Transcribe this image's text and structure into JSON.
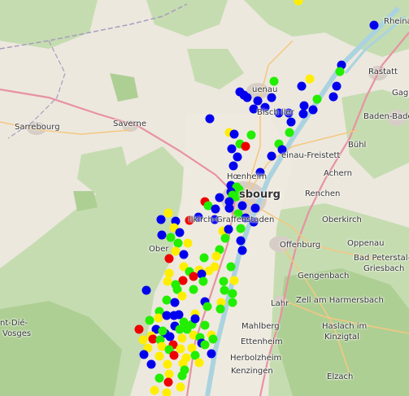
{
  "map": {
    "labels": [
      {
        "id": "rheinau",
        "text": "Rheinau"
      },
      {
        "id": "rastatt",
        "text": "Rastatt"
      },
      {
        "id": "gag",
        "text": "Gag"
      },
      {
        "id": "haguenau",
        "text": "uenau"
      },
      {
        "id": "bischwiller",
        "text": "Bisch ller"
      },
      {
        "id": "baden-baden",
        "text": "Baden-Bade"
      },
      {
        "id": "sarrebourg",
        "text": "Sarrebourg"
      },
      {
        "id": "saverne",
        "text": "Saverne"
      },
      {
        "id": "buhl",
        "text": "Bühl"
      },
      {
        "id": "freistett",
        "text": "einau-Freistett"
      },
      {
        "id": "achern",
        "text": "Achern"
      },
      {
        "id": "hoenheim",
        "text": "Hœnheim"
      },
      {
        "id": "strasbourg",
        "text": "sbourg"
      },
      {
        "id": "renchen",
        "text": "Renchen"
      },
      {
        "id": "illkirch",
        "text": "llkirch-Graffenstaden"
      },
      {
        "id": "oberkirch",
        "text": "Oberkirch"
      },
      {
        "id": "offenburg",
        "text": "Offenburg"
      },
      {
        "id": "oppenau",
        "text": "Oppenau"
      },
      {
        "id": "obernai",
        "text": "Ober"
      },
      {
        "id": "peterstal",
        "text": "Bad Peterstal-"
      },
      {
        "id": "griesbach",
        "text": "Griesbach"
      },
      {
        "id": "gengenbach",
        "text": "Gengenbach"
      },
      {
        "id": "lahr",
        "text": "Lahr"
      },
      {
        "id": "zell",
        "text": "Zell am Harmersbach"
      },
      {
        "id": "saintdie",
        "text": "nt-Dié-"
      },
      {
        "id": "vosges",
        "text": "Vosges"
      },
      {
        "id": "mahlberg",
        "text": "Mahlberg"
      },
      {
        "id": "haslach",
        "text": "Haslach im"
      },
      {
        "id": "kinzigtal",
        "text": "Kinzigtal"
      },
      {
        "id": "ettenheim",
        "text": "Ettenheim"
      },
      {
        "id": "herbolzheim",
        "text": "Herbolzheim"
      },
      {
        "id": "kenzingen",
        "text": "Kenzingen"
      },
      {
        "id": "elzach",
        "text": "Elzach"
      }
    ],
    "colors": {
      "blue": "#0000ee",
      "green": "#22ee00",
      "yellow": "#ffee00",
      "red": "#ee0000",
      "forest": "#b9d6a3",
      "urban": "#d9d0c9",
      "water": "#aad3df",
      "motorway": "#e892a2",
      "primary": "#fcd6a4",
      "border": "#9e86b3"
    },
    "markers": [
      {
        "x": 0,
        "y": 0,
        "c": "yellow"
      }
    ]
  }
}
